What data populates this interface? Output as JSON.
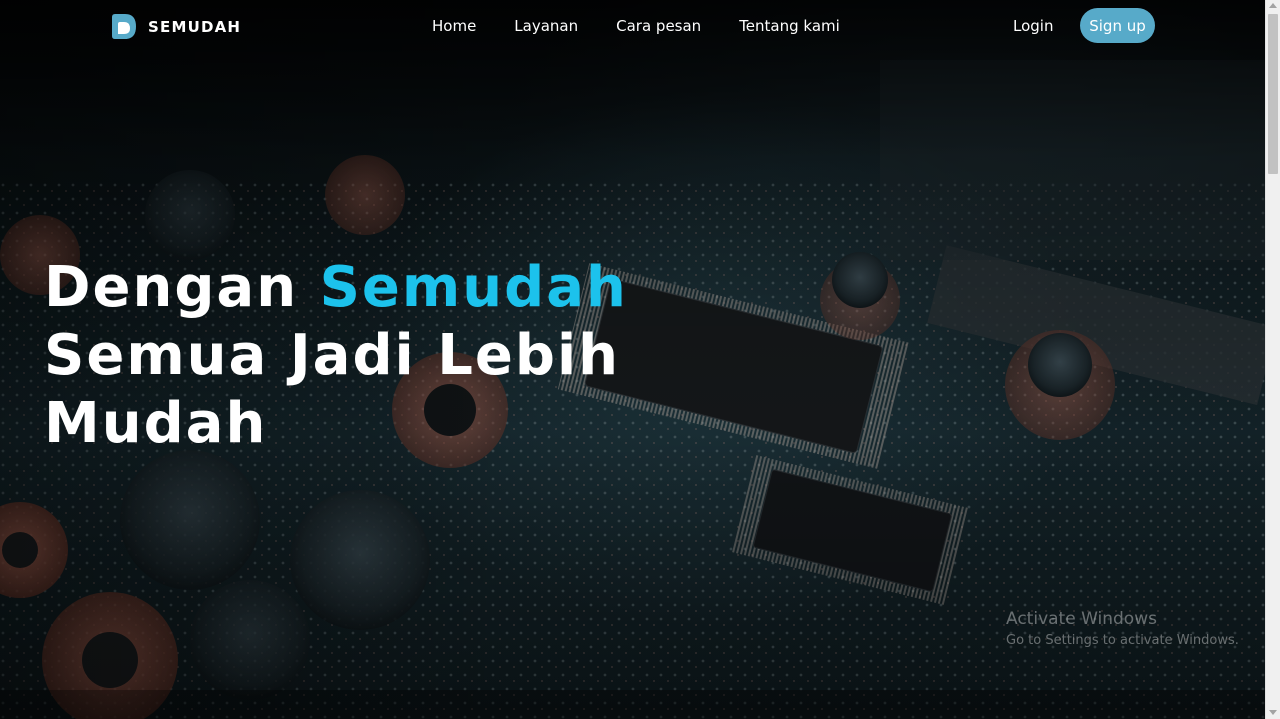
{
  "brand": {
    "name": "SEMUDAH",
    "logo_icon": "semudah-logo-icon"
  },
  "nav": {
    "links": [
      "Home",
      "Layanan",
      "Cara pesan",
      "Tentang kami"
    ],
    "login_label": "Login",
    "signup_label": "Sign up"
  },
  "hero": {
    "headline_part1": "Dengan ",
    "headline_accent": "Semudah",
    "headline_line2": "Semua Jadi Lebih",
    "headline_line3": "Mudah",
    "background_image": "circuit-board-photo"
  },
  "watermark": {
    "title": "Activate Windows",
    "subtitle": "Go to Settings to activate Windows."
  },
  "colors": {
    "accent": "#1cc2ec",
    "signup_bg": "#57aac9",
    "text": "#ffffff"
  }
}
